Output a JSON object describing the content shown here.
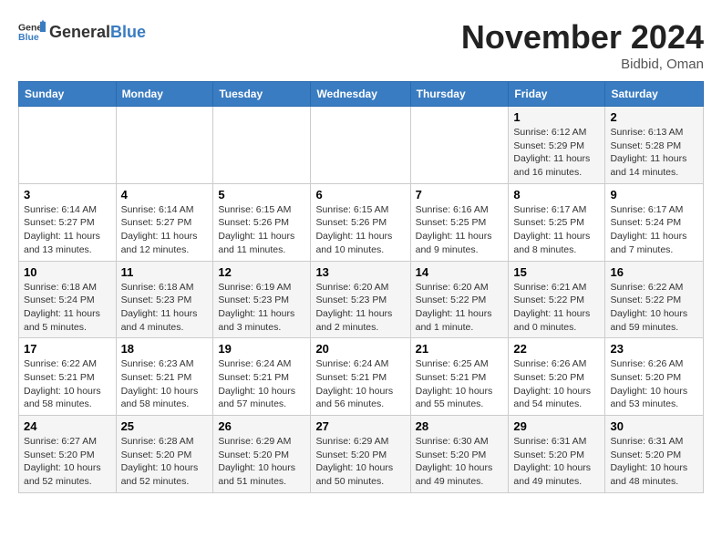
{
  "header": {
    "logo_general": "General",
    "logo_blue": "Blue",
    "month_title": "November 2024",
    "location": "Bidbid, Oman"
  },
  "weekdays": [
    "Sunday",
    "Monday",
    "Tuesday",
    "Wednesday",
    "Thursday",
    "Friday",
    "Saturday"
  ],
  "weeks": [
    [
      {
        "day": "",
        "info": ""
      },
      {
        "day": "",
        "info": ""
      },
      {
        "day": "",
        "info": ""
      },
      {
        "day": "",
        "info": ""
      },
      {
        "day": "",
        "info": ""
      },
      {
        "day": "1",
        "info": "Sunrise: 6:12 AM\nSunset: 5:29 PM\nDaylight: 11 hours and 16 minutes."
      },
      {
        "day": "2",
        "info": "Sunrise: 6:13 AM\nSunset: 5:28 PM\nDaylight: 11 hours and 14 minutes."
      }
    ],
    [
      {
        "day": "3",
        "info": "Sunrise: 6:14 AM\nSunset: 5:27 PM\nDaylight: 11 hours and 13 minutes."
      },
      {
        "day": "4",
        "info": "Sunrise: 6:14 AM\nSunset: 5:27 PM\nDaylight: 11 hours and 12 minutes."
      },
      {
        "day": "5",
        "info": "Sunrise: 6:15 AM\nSunset: 5:26 PM\nDaylight: 11 hours and 11 minutes."
      },
      {
        "day": "6",
        "info": "Sunrise: 6:15 AM\nSunset: 5:26 PM\nDaylight: 11 hours and 10 minutes."
      },
      {
        "day": "7",
        "info": "Sunrise: 6:16 AM\nSunset: 5:25 PM\nDaylight: 11 hours and 9 minutes."
      },
      {
        "day": "8",
        "info": "Sunrise: 6:17 AM\nSunset: 5:25 PM\nDaylight: 11 hours and 8 minutes."
      },
      {
        "day": "9",
        "info": "Sunrise: 6:17 AM\nSunset: 5:24 PM\nDaylight: 11 hours and 7 minutes."
      }
    ],
    [
      {
        "day": "10",
        "info": "Sunrise: 6:18 AM\nSunset: 5:24 PM\nDaylight: 11 hours and 5 minutes."
      },
      {
        "day": "11",
        "info": "Sunrise: 6:18 AM\nSunset: 5:23 PM\nDaylight: 11 hours and 4 minutes."
      },
      {
        "day": "12",
        "info": "Sunrise: 6:19 AM\nSunset: 5:23 PM\nDaylight: 11 hours and 3 minutes."
      },
      {
        "day": "13",
        "info": "Sunrise: 6:20 AM\nSunset: 5:23 PM\nDaylight: 11 hours and 2 minutes."
      },
      {
        "day": "14",
        "info": "Sunrise: 6:20 AM\nSunset: 5:22 PM\nDaylight: 11 hours and 1 minute."
      },
      {
        "day": "15",
        "info": "Sunrise: 6:21 AM\nSunset: 5:22 PM\nDaylight: 11 hours and 0 minutes."
      },
      {
        "day": "16",
        "info": "Sunrise: 6:22 AM\nSunset: 5:22 PM\nDaylight: 10 hours and 59 minutes."
      }
    ],
    [
      {
        "day": "17",
        "info": "Sunrise: 6:22 AM\nSunset: 5:21 PM\nDaylight: 10 hours and 58 minutes."
      },
      {
        "day": "18",
        "info": "Sunrise: 6:23 AM\nSunset: 5:21 PM\nDaylight: 10 hours and 58 minutes."
      },
      {
        "day": "19",
        "info": "Sunrise: 6:24 AM\nSunset: 5:21 PM\nDaylight: 10 hours and 57 minutes."
      },
      {
        "day": "20",
        "info": "Sunrise: 6:24 AM\nSunset: 5:21 PM\nDaylight: 10 hours and 56 minutes."
      },
      {
        "day": "21",
        "info": "Sunrise: 6:25 AM\nSunset: 5:21 PM\nDaylight: 10 hours and 55 minutes."
      },
      {
        "day": "22",
        "info": "Sunrise: 6:26 AM\nSunset: 5:20 PM\nDaylight: 10 hours and 54 minutes."
      },
      {
        "day": "23",
        "info": "Sunrise: 6:26 AM\nSunset: 5:20 PM\nDaylight: 10 hours and 53 minutes."
      }
    ],
    [
      {
        "day": "24",
        "info": "Sunrise: 6:27 AM\nSunset: 5:20 PM\nDaylight: 10 hours and 52 minutes."
      },
      {
        "day": "25",
        "info": "Sunrise: 6:28 AM\nSunset: 5:20 PM\nDaylight: 10 hours and 52 minutes."
      },
      {
        "day": "26",
        "info": "Sunrise: 6:29 AM\nSunset: 5:20 PM\nDaylight: 10 hours and 51 minutes."
      },
      {
        "day": "27",
        "info": "Sunrise: 6:29 AM\nSunset: 5:20 PM\nDaylight: 10 hours and 50 minutes."
      },
      {
        "day": "28",
        "info": "Sunrise: 6:30 AM\nSunset: 5:20 PM\nDaylight: 10 hours and 49 minutes."
      },
      {
        "day": "29",
        "info": "Sunrise: 6:31 AM\nSunset: 5:20 PM\nDaylight: 10 hours and 49 minutes."
      },
      {
        "day": "30",
        "info": "Sunrise: 6:31 AM\nSunset: 5:20 PM\nDaylight: 10 hours and 48 minutes."
      }
    ]
  ]
}
